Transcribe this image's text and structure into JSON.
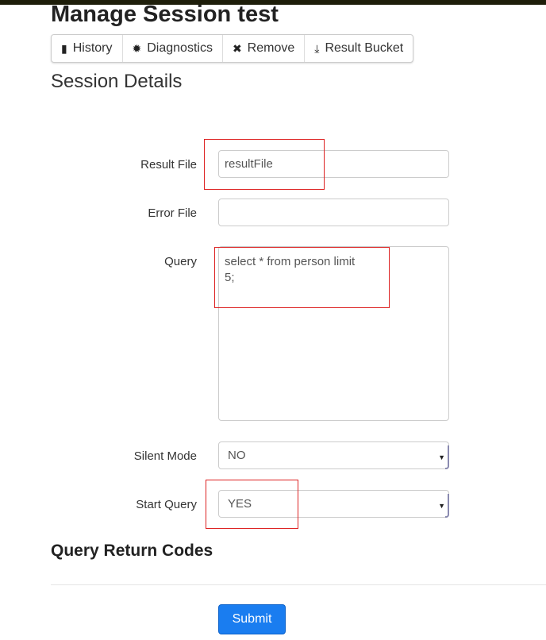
{
  "page_title": "Manage Session test",
  "toolbar": [
    {
      "icon": "book-icon",
      "glyph": "▮",
      "label": "History"
    },
    {
      "icon": "gear-icon",
      "glyph": "✹",
      "label": "Diagnostics"
    },
    {
      "icon": "close-icon",
      "glyph": "✖",
      "label": "Remove"
    },
    {
      "icon": "download-icon",
      "glyph": "⤓",
      "label": "Result Bucket"
    }
  ],
  "section_title": "Session Details",
  "form": {
    "result_file": {
      "label": "Result File",
      "value": "resultFile"
    },
    "error_file": {
      "label": "Error File",
      "value": ""
    },
    "query": {
      "label": "Query",
      "value": "select * from person limit\n5;"
    },
    "silent_mode": {
      "label": "Silent Mode",
      "value": "NO"
    },
    "start_query": {
      "label": "Start Query",
      "value": "YES"
    }
  },
  "return_codes_title": "Query Return Codes",
  "submit_label": "Submit",
  "colors": {
    "accent": "#1a7df0",
    "highlight": "#dd2222"
  }
}
